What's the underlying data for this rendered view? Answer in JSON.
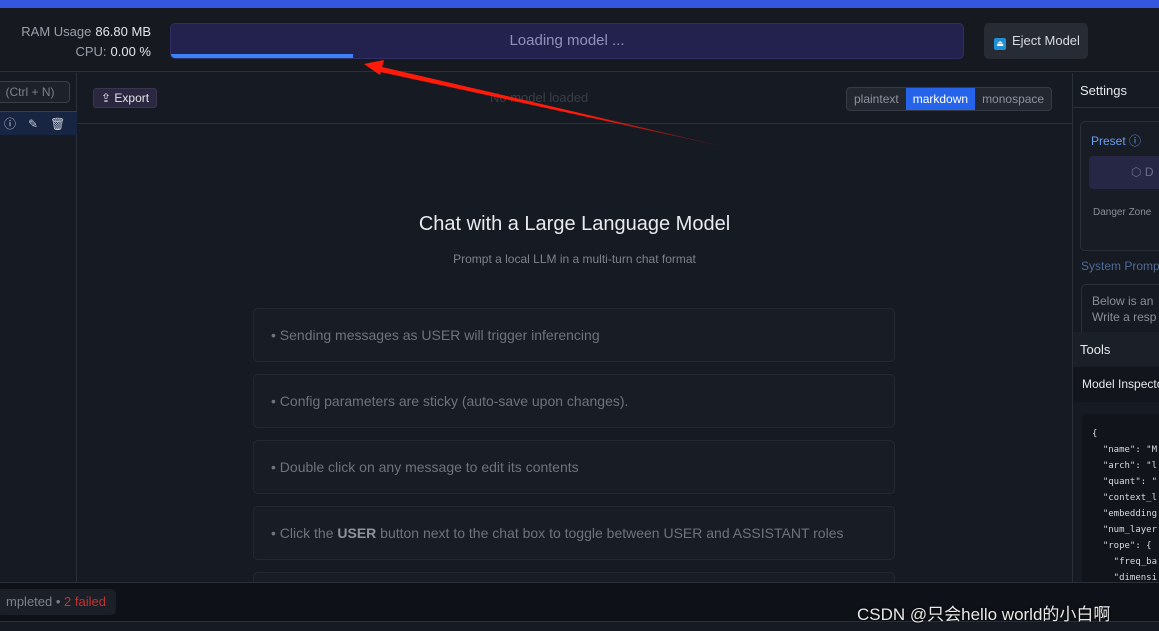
{
  "header": {
    "ram_label": "RAM Usage",
    "ram_value": "86.80 MB",
    "cpu_label": "CPU:",
    "cpu_value": "0.00 %",
    "loading_text": "Loading model ...",
    "loading_progress_percent": 23,
    "eject_label": "Eject Model"
  },
  "sidebar": {
    "new_chat_shortcut": "(Ctrl + N)"
  },
  "main": {
    "export_label": "Export",
    "no_model_text": "No model loaded",
    "format_options": [
      "plaintext",
      "markdown",
      "monospace"
    ],
    "selected_format": "markdown",
    "title": "Chat with a Large Language Model",
    "subtitle": "Prompt a local LLM in a multi-turn chat format",
    "tips": [
      "• Sending messages as USER will trigger inferencing",
      "• Config parameters are sticky (auto-save upon changes).",
      "• Double click on any message to edit its contents"
    ],
    "tip4": {
      "pre": "• Click the ",
      "bold": "USER",
      "post": " button next to the chat box to toggle between USER and ASSISTANT roles"
    }
  },
  "settings": {
    "title": "Settings",
    "preset_label": "Preset",
    "preset_button": "D",
    "danger_zone": "Danger Zone",
    "system_prompt_label": "System Promp",
    "system_prompt_text": "Below is an\nWrite a resp"
  },
  "tools": {
    "title": "Tools",
    "model_inspector": "Model Inspecto",
    "json_preview": "{\n  \"name\": \"M\n  \"arch\": \"l\n  \"quant\": \"\n  \"context_l\n  \"embedding\n  \"num_layer\n  \"rope\": {\n    \"freq_ba\n    \"dimensi"
  },
  "footer": {
    "status_completed": "mpleted",
    "status_sep": " • ",
    "status_failed": "2 failed"
  },
  "watermark": "CSDN @只会hello world的小白啊",
  "colors": {
    "accent": "#2563eb",
    "progress": "#3b82f6",
    "failed": "#c53030",
    "annotation_arrow": "#ff1a0a"
  }
}
